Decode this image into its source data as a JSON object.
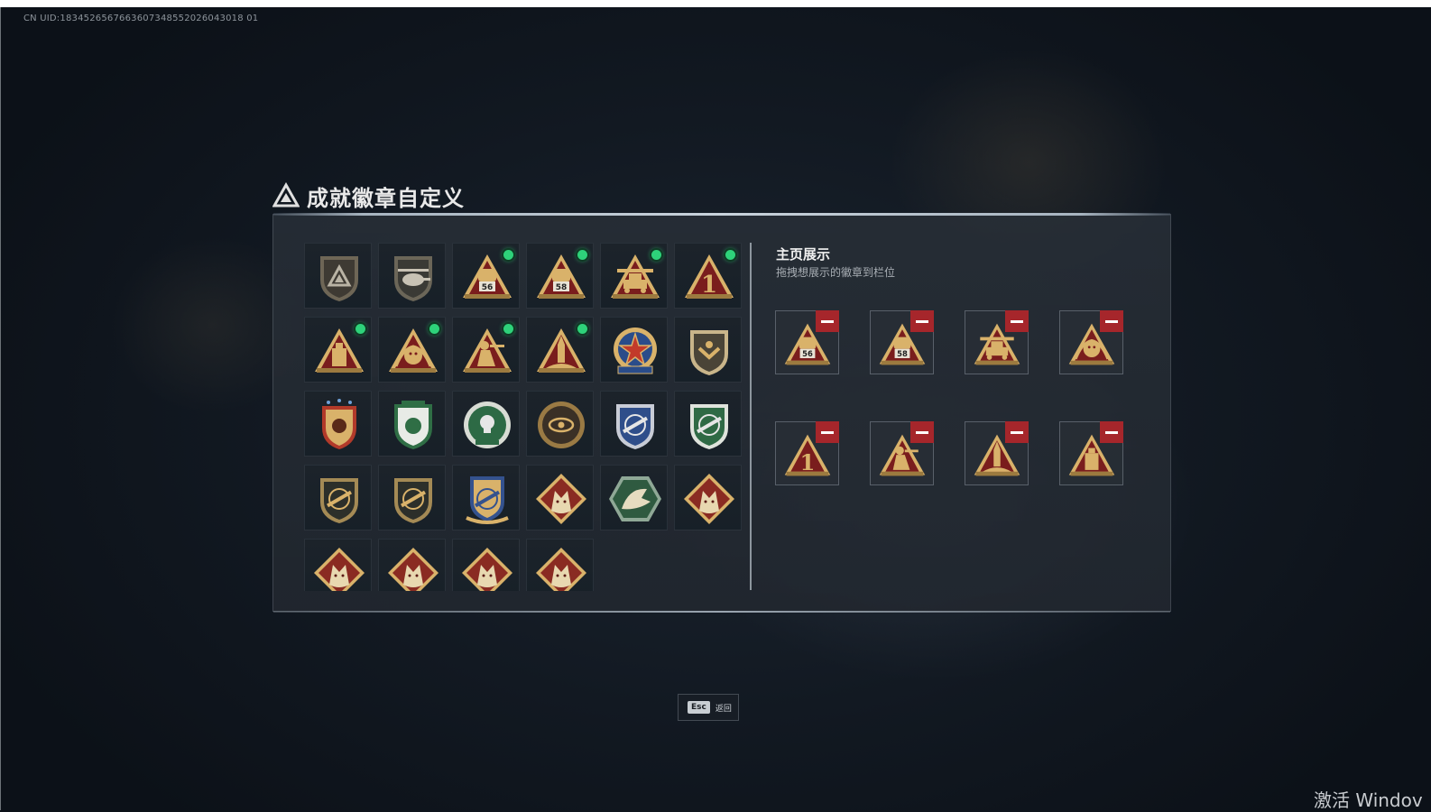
{
  "uid_text": "CN UID:1834526567663607348552026043018 01",
  "title": "成就徽章自定义",
  "side_panel": {
    "title": "主页展示",
    "subtitle": "拖拽想展示的徽章到栏位"
  },
  "esc": {
    "key": "Esc",
    "label": "返回"
  },
  "watermark": "激活 Windov",
  "badge_grid": [
    {
      "icon": "shield-emblem-badge-icon",
      "new": false
    },
    {
      "icon": "helicopter-badge-icon",
      "new": false
    },
    {
      "icon": "triangle-badge-56-icon",
      "num": "56",
      "new": true
    },
    {
      "icon": "triangle-badge-58-icon",
      "num": "58",
      "new": true
    },
    {
      "icon": "triangle-badge-tank-icon",
      "new": true
    },
    {
      "icon": "triangle-badge-rank-1-icon",
      "num": "1",
      "new": true
    },
    {
      "icon": "triangle-badge-crate-icon",
      "new": true
    },
    {
      "icon": "triangle-badge-lion-icon",
      "new": true
    },
    {
      "icon": "triangle-badge-soldier-icon",
      "new": true
    },
    {
      "icon": "triangle-badge-rocket-icon",
      "new": true
    },
    {
      "icon": "round-star-badge-icon",
      "new": false
    },
    {
      "icon": "shield-chevron-badge-icon",
      "new": false
    },
    {
      "icon": "star-shield-badge-icon",
      "new": false
    },
    {
      "icon": "green-lion-shield-badge-icon",
      "new": false
    },
    {
      "icon": "green-skull-round-badge-icon",
      "new": false
    },
    {
      "icon": "eye-round-badge-icon",
      "new": false
    },
    {
      "icon": "blue-rifle-shield-badge-icon",
      "new": false
    },
    {
      "icon": "green-rifle-round-badge-icon",
      "new": false
    },
    {
      "icon": "rifle-shield-badge-icon",
      "new": false
    },
    {
      "icon": "sniper-shield-badge-icon",
      "new": false
    },
    {
      "icon": "blue-crest-badge-icon",
      "new": false
    },
    {
      "icon": "wolf-diamond-badge-icon",
      "new": false
    },
    {
      "icon": "dragon-hexagon-badge-icon",
      "new": false
    },
    {
      "icon": "dragon-diamond-badge-icon",
      "new": false
    },
    {
      "icon": "dragon-diamond-badge-icon",
      "new": false
    },
    {
      "icon": "soldier-diamond-badge-icon",
      "new": false
    },
    {
      "icon": "horse-diamond-badge-icon",
      "new": false
    },
    {
      "icon": "wrench-diamond-badge-icon",
      "new": false
    }
  ],
  "showcase": [
    {
      "icon": "triangle-badge-56-icon",
      "num": "56"
    },
    {
      "icon": "triangle-badge-58-icon",
      "num": "58"
    },
    {
      "icon": "triangle-badge-tank-icon"
    },
    {
      "icon": "triangle-badge-lion-icon"
    },
    {
      "icon": "triangle-badge-rank-1-icon",
      "num": "1"
    },
    {
      "icon": "triangle-badge-soldier-icon"
    },
    {
      "icon": "triangle-badge-rocket-icon"
    },
    {
      "icon": "triangle-badge-crate-icon"
    }
  ]
}
